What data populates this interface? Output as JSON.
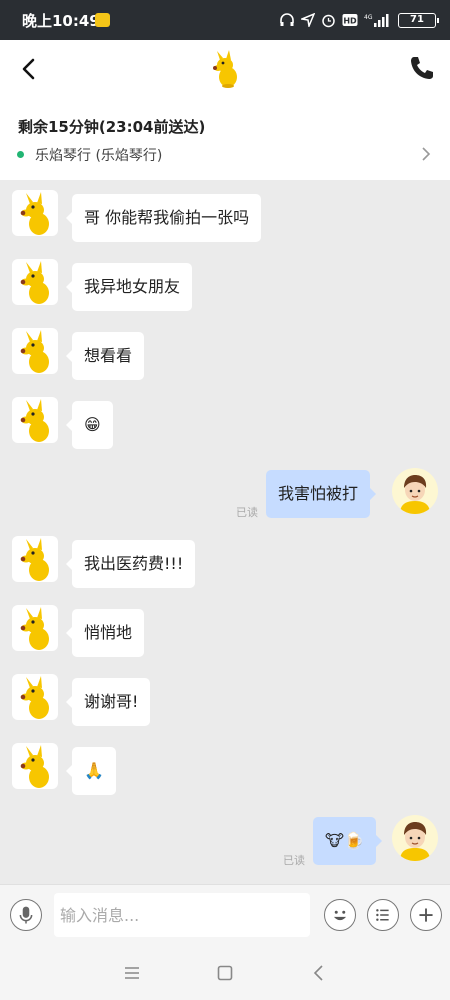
{
  "status_bar": {
    "time": "晚上10:49",
    "battery": "71",
    "network": "4G"
  },
  "nav": {
    "back_icon": "chevron-left-icon",
    "logo_icon": "yellow-kangaroo-icon",
    "call_icon": "phone-icon"
  },
  "delivery": {
    "title": "剩余15分钟(23:04前送达)",
    "shop": "乐焰琴行 (乐焰琴行)",
    "status_color": "#22b573"
  },
  "messages": [
    {
      "side": "left",
      "text": "哥 你能帮我偷拍一张吗"
    },
    {
      "side": "left",
      "text": "我异地女朋友"
    },
    {
      "side": "left",
      "text": "想看看"
    },
    {
      "side": "left",
      "text": "😁"
    },
    {
      "side": "right",
      "text": "我害怕被打",
      "read": "已读"
    },
    {
      "side": "left",
      "text": "我出医药费!!!"
    },
    {
      "side": "left",
      "text": "悄悄地"
    },
    {
      "side": "left",
      "text": "谢谢哥!"
    },
    {
      "side": "left",
      "text": "🙏"
    },
    {
      "side": "right",
      "text": "🐮🍺",
      "read": "已读"
    }
  ],
  "input": {
    "placeholder": "输入消息..."
  },
  "colors": {
    "bubble_right": "#c6dcff",
    "bubble_left": "#ffffff",
    "background": "#ebebeb"
  }
}
